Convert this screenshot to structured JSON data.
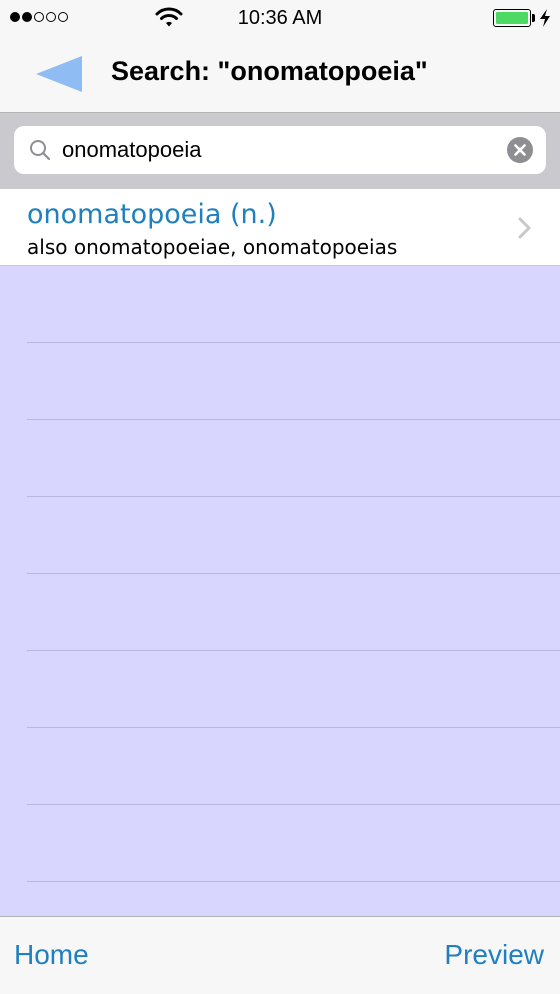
{
  "status_bar": {
    "time": "10:36 AM",
    "signal_bars_filled": 2,
    "signal_bars_total": 5,
    "battery_level": 1.0,
    "battery_color": "#4cd964"
  },
  "nav": {
    "title": "Search: \"onomatopoeia\"",
    "back_icon": "back-triangle-icon",
    "accent_color": "#8fbcf2"
  },
  "search": {
    "value": "onomatopoeia",
    "icon": "search-icon",
    "clear_icon": "clear-icon"
  },
  "results": [
    {
      "title": "onomatopoeia (n.)",
      "subtitle": "also onomatopoeiae, onomatopoeias",
      "icon": "chevron-right-icon"
    }
  ],
  "tab_bar": {
    "home_label": "Home",
    "preview_label": "Preview"
  },
  "colors": {
    "link": "#1f7fbf",
    "list_background": "#d8d6ff"
  }
}
